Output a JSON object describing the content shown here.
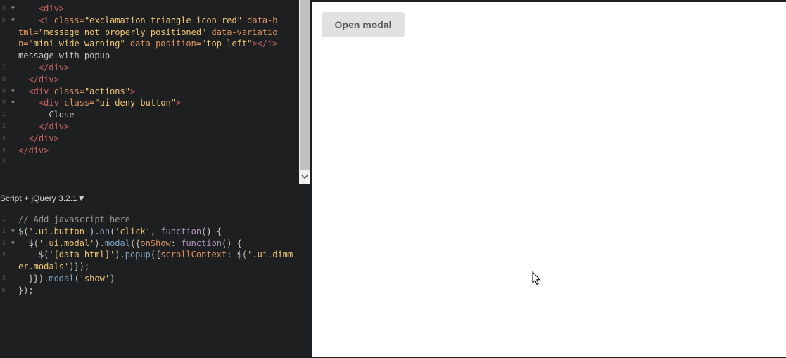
{
  "html_code": {
    "lines": [
      {
        "n": "5",
        "fold": true,
        "parts": [
          [
            "txt",
            "    "
          ],
          [
            "tag",
            "<div>"
          ]
        ]
      },
      {
        "n": "6",
        "fold": true,
        "parts": [
          [
            "txt",
            "    "
          ],
          [
            "tag",
            "<i "
          ],
          [
            "attr",
            "class="
          ],
          [
            "str",
            "\"exclamation triangle icon red\""
          ],
          [
            "attr",
            " data-h"
          ]
        ]
      },
      {
        "n": "",
        "fold": false,
        "parts": [
          [
            "attr",
            "tml="
          ],
          [
            "str",
            "\"message not properly positioned\""
          ],
          [
            "attr",
            " data-variatio"
          ]
        ]
      },
      {
        "n": "",
        "fold": false,
        "parts": [
          [
            "attr",
            "n="
          ],
          [
            "str",
            "\"mini wide warning\""
          ],
          [
            "attr",
            " data-position="
          ],
          [
            "str",
            "\"top left\""
          ],
          [
            "tag",
            "></i>"
          ]
        ]
      },
      {
        "n": "",
        "fold": false,
        "parts": [
          [
            "txt",
            "message with popup"
          ]
        ]
      },
      {
        "n": "7",
        "fold": false,
        "parts": [
          [
            "txt",
            "    "
          ],
          [
            "tag",
            "</div>"
          ]
        ]
      },
      {
        "n": "8",
        "fold": false,
        "parts": [
          [
            "txt",
            "  "
          ],
          [
            "tag",
            "</div>"
          ]
        ]
      },
      {
        "n": "9",
        "fold": true,
        "parts": [
          [
            "txt",
            "  "
          ],
          [
            "tag",
            "<div "
          ],
          [
            "attr",
            "class="
          ],
          [
            "str",
            "\"actions\""
          ],
          [
            "tag",
            ">"
          ]
        ]
      },
      {
        "n": "0",
        "fold": true,
        "parts": [
          [
            "txt",
            "    "
          ],
          [
            "tag",
            "<div "
          ],
          [
            "attr",
            "class="
          ],
          [
            "str",
            "\"ui deny button\""
          ],
          [
            "tag",
            ">"
          ]
        ]
      },
      {
        "n": "1",
        "fold": false,
        "parts": [
          [
            "txt",
            "      Close"
          ]
        ]
      },
      {
        "n": "2",
        "fold": false,
        "parts": [
          [
            "txt",
            "    "
          ],
          [
            "tag",
            "</div>"
          ]
        ]
      },
      {
        "n": "3",
        "fold": false,
        "parts": [
          [
            "txt",
            "  "
          ],
          [
            "tag",
            "</div>"
          ]
        ]
      },
      {
        "n": "4",
        "fold": false,
        "parts": [
          [
            "tag",
            "</div>"
          ]
        ]
      },
      {
        "n": "5",
        "fold": false,
        "parts": [
          [
            "txt",
            ""
          ]
        ]
      }
    ]
  },
  "js_panel": {
    "label": "Script + jQuery 3.2.1",
    "label_caret": "▼"
  },
  "js_code": {
    "lines": [
      {
        "n": "1",
        "fold": false,
        "parts": [
          [
            "cm",
            "// Add javascript here"
          ]
        ]
      },
      {
        "n": "2",
        "fold": true,
        "parts": [
          [
            "txt",
            "$("
          ],
          [
            "str",
            "'.ui.button'"
          ],
          [
            "txt",
            ")."
          ],
          [
            "fn",
            "on"
          ],
          [
            "txt",
            "("
          ],
          [
            "str",
            "'click'"
          ],
          [
            "txt",
            ", "
          ],
          [
            "kw",
            "function"
          ],
          [
            "txt",
            "() {"
          ]
        ]
      },
      {
        "n": "3",
        "fold": true,
        "parts": [
          [
            "txt",
            "  $("
          ],
          [
            "str",
            "'.ui.modal'"
          ],
          [
            "txt",
            ")."
          ],
          [
            "fn",
            "modal"
          ],
          [
            "txt",
            "({"
          ],
          [
            "attr",
            "onShow"
          ],
          [
            "txt",
            ": "
          ],
          [
            "kw",
            "function"
          ],
          [
            "txt",
            "() {"
          ]
        ]
      },
      {
        "n": "4",
        "fold": false,
        "parts": [
          [
            "txt",
            "    $("
          ],
          [
            "str",
            "'[data-html]'"
          ],
          [
            "txt",
            ")."
          ],
          [
            "fn",
            "popup"
          ],
          [
            "txt",
            "({"
          ],
          [
            "attr",
            "scrollContext"
          ],
          [
            "txt",
            ": $("
          ],
          [
            "str",
            "'.ui.dimm"
          ]
        ]
      },
      {
        "n": "",
        "fold": false,
        "parts": [
          [
            "str",
            "er.modals'"
          ],
          [
            "txt",
            ")});"
          ]
        ]
      },
      {
        "n": "5",
        "fold": false,
        "parts": [
          [
            "txt",
            "  }})."
          ],
          [
            "fn",
            "modal"
          ],
          [
            "txt",
            "("
          ],
          [
            "str",
            "'show'"
          ],
          [
            "txt",
            ")"
          ]
        ]
      },
      {
        "n": "6",
        "fold": false,
        "parts": [
          [
            "txt",
            "});"
          ]
        ]
      }
    ]
  },
  "preview": {
    "open_modal_label": "Open modal"
  },
  "scroll": {
    "down_arrow": "⌄"
  }
}
